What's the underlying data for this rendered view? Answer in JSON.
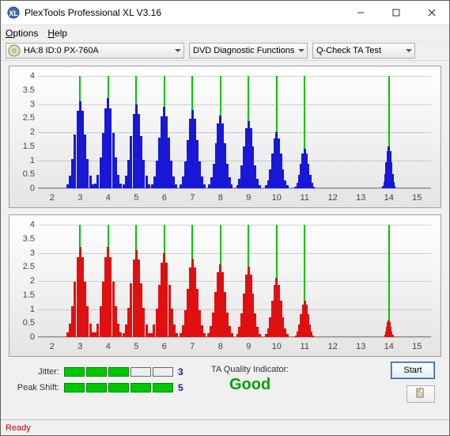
{
  "window": {
    "title": "PlexTools Professional XL V3.16"
  },
  "menu": {
    "options": "Options",
    "help": "Help"
  },
  "toolbar": {
    "drive_label": "HA:8 ID:0  PX-760A",
    "fn_label": "DVD Diagnostic Functions",
    "test_label": "Q-Check TA Test"
  },
  "chart_data": [
    {
      "type": "bar",
      "color": "#1818d6",
      "xlim": [
        1.5,
        15.5
      ],
      "ylim": [
        0,
        4
      ],
      "xticks": [
        2,
        3,
        4,
        5,
        6,
        7,
        8,
        9,
        10,
        11,
        12,
        13,
        14,
        15
      ],
      "yticks": [
        0,
        0.5,
        1,
        1.5,
        2,
        2.5,
        3,
        3.5,
        4
      ],
      "clusters": [
        {
          "center": 3,
          "peak": 3.1,
          "width": 0.9
        },
        {
          "center": 4,
          "peak": 3.2,
          "width": 0.9
        },
        {
          "center": 5,
          "peak": 3.0,
          "width": 0.9
        },
        {
          "center": 6,
          "peak": 2.9,
          "width": 0.85
        },
        {
          "center": 7,
          "peak": 2.8,
          "width": 0.85
        },
        {
          "center": 8,
          "peak": 2.6,
          "width": 0.8
        },
        {
          "center": 9,
          "peak": 2.4,
          "width": 0.8
        },
        {
          "center": 10,
          "peak": 2.0,
          "width": 0.75
        },
        {
          "center": 11,
          "peak": 1.4,
          "width": 0.65
        },
        {
          "center": 14,
          "peak": 1.5,
          "width": 0.4
        }
      ]
    },
    {
      "type": "bar",
      "color": "#e01010",
      "xlim": [
        1.5,
        15.5
      ],
      "ylim": [
        0,
        4
      ],
      "xticks": [
        2,
        3,
        4,
        5,
        6,
        7,
        8,
        9,
        10,
        11,
        12,
        13,
        14,
        15
      ],
      "yticks": [
        0,
        0.5,
        1,
        1.5,
        2,
        2.5,
        3,
        3.5,
        4
      ],
      "clusters": [
        {
          "center": 3,
          "peak": 3.2,
          "width": 0.9
        },
        {
          "center": 4,
          "peak": 3.2,
          "width": 0.9
        },
        {
          "center": 5,
          "peak": 3.1,
          "width": 0.9
        },
        {
          "center": 6,
          "peak": 3.0,
          "width": 0.9
        },
        {
          "center": 7,
          "peak": 2.8,
          "width": 0.85
        },
        {
          "center": 8,
          "peak": 2.6,
          "width": 0.85
        },
        {
          "center": 9,
          "peak": 2.5,
          "width": 0.8
        },
        {
          "center": 10,
          "peak": 2.1,
          "width": 0.75
        },
        {
          "center": 11,
          "peak": 1.3,
          "width": 0.6
        },
        {
          "center": 14,
          "peak": 0.6,
          "width": 0.3
        }
      ]
    }
  ],
  "metrics": {
    "jitter": {
      "label": "Jitter:",
      "value": 3,
      "max": 5
    },
    "peak_shift": {
      "label": "Peak Shift:",
      "value": 5,
      "max": 5
    }
  },
  "quality": {
    "caption": "TA Quality Indicator:",
    "value": "Good",
    "color": "#00a000"
  },
  "buttons": {
    "start": "Start"
  },
  "status": {
    "text": "Ready"
  }
}
